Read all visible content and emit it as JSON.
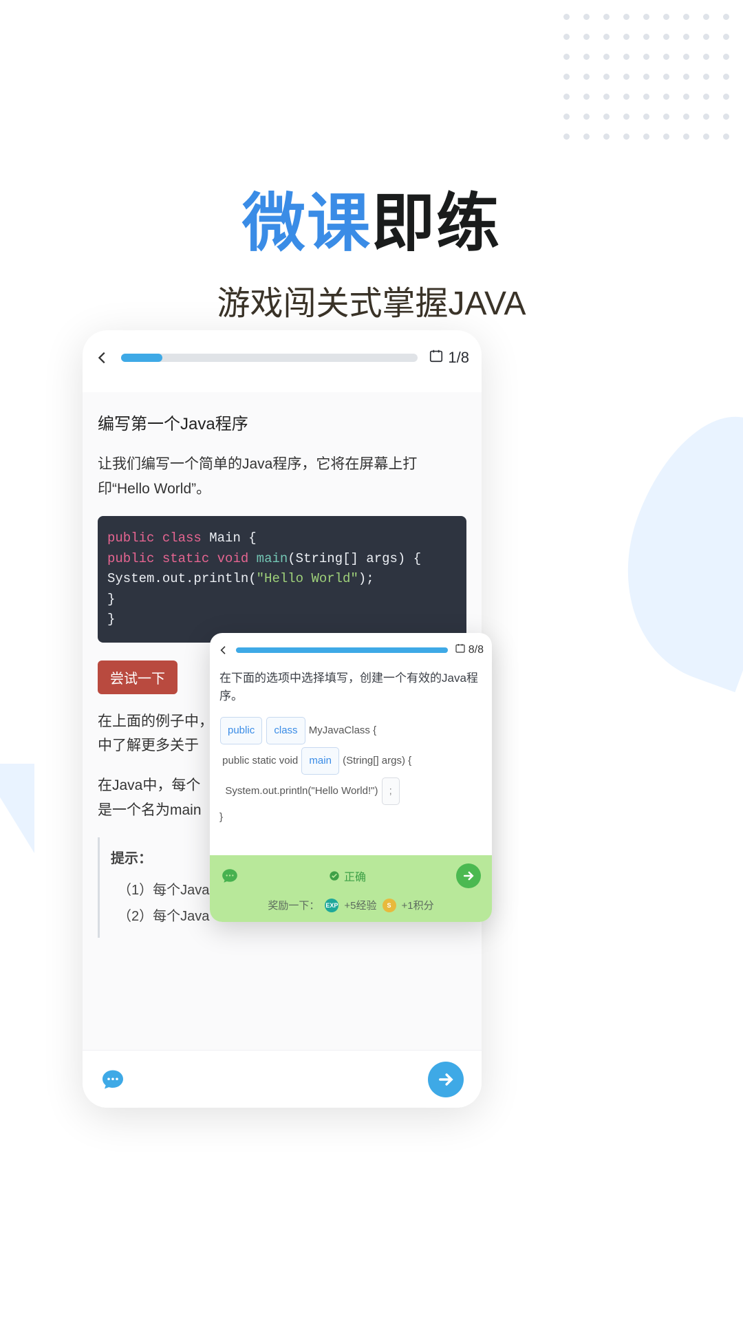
{
  "hero": {
    "title_blue": "微课",
    "title_black": "即练",
    "subtitle": "游戏闯关式掌握JAVA"
  },
  "main_card": {
    "progress_label": "1/8",
    "heading": "编写第一个Java程序",
    "intro": "让我们编写一个简单的Java程序，它将在屏幕上打印“Hello World”。",
    "code": {
      "l1_kw1": "public",
      "l1_kw2": "class",
      "l1_name": "Main {",
      "l2_indent": "  ",
      "l2_kw1": "public",
      "l2_kw2": "static",
      "l2_kw3": "void",
      "l2_fn": "main",
      "l2_rest": "(String[] args) {",
      "l3_indent": "    ",
      "l3_call": "System.out.println(",
      "l3_str": "\"Hello World\"",
      "l3_end": ");",
      "l4": "  }",
      "l5": "}"
    },
    "try_label": "尝试一下",
    "para2": "在上面的例子中，",
    "para2b": "中了解更多关于",
    "para3a": "在Java中，每个",
    "para3b": "是一个名为main",
    "hint_title": "提示：",
    "hint1": "（1）每个Java",
    "hint2": "（2）每个Java"
  },
  "quiz_card": {
    "progress_label": "8/8",
    "question": "在下面的选项中选择填写，创建一个有效的Java程序。",
    "tok_public": "public",
    "tok_class": "class",
    "tok_rest1": "MyJavaClass {",
    "line2_pre": "public static void",
    "tok_main": "main",
    "line2_post": "(String[] args) {",
    "line3_pre": "System.out.println(\"Hello World!\")",
    "tok_semi": ";",
    "line4": "}",
    "correct_label": "正确",
    "reward_prefix": "奖励一下：",
    "reward_exp": "+5经验",
    "reward_points": "+1积分",
    "exp_badge": "EXP",
    "coin_badge": "S"
  }
}
